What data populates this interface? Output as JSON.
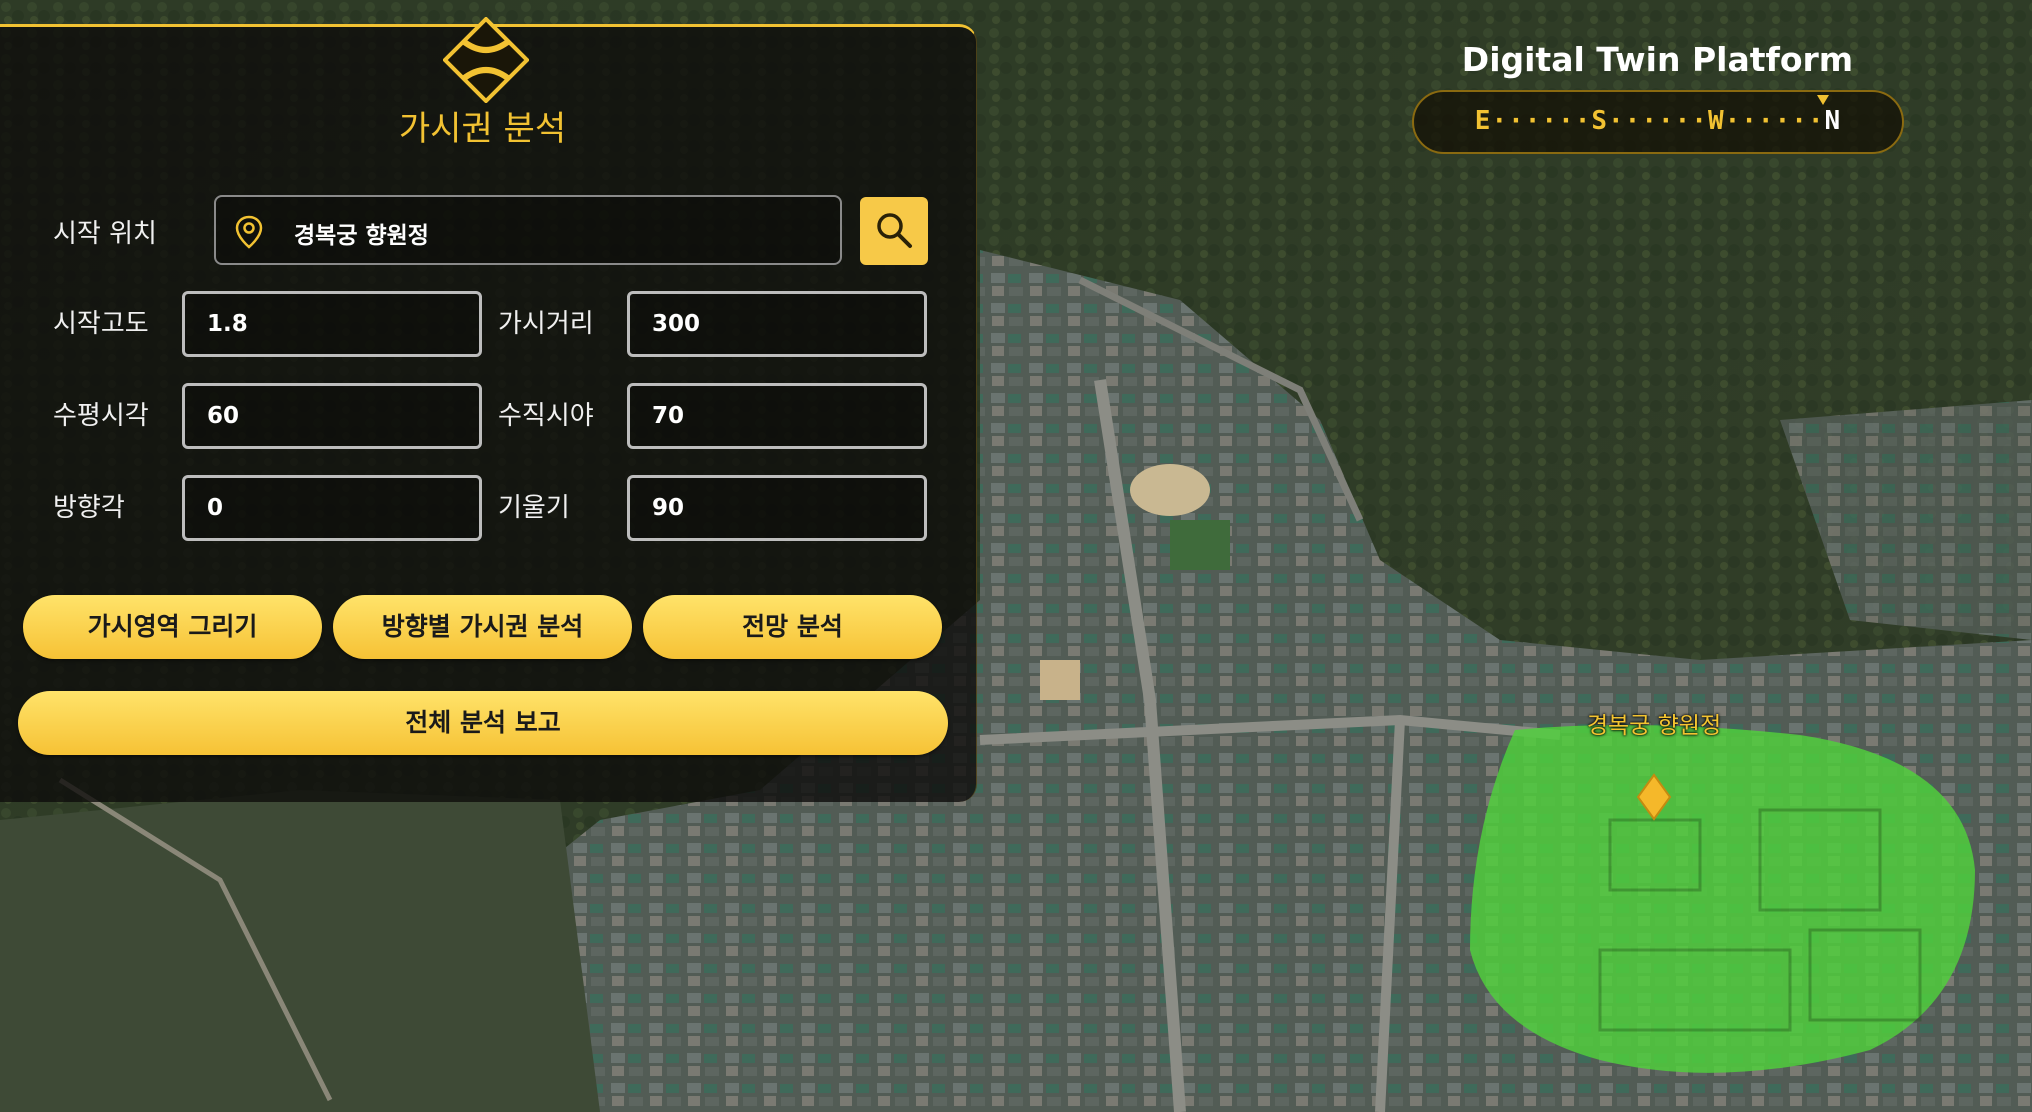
{
  "app": {
    "platform_title": "Digital Twin Platform"
  },
  "panel": {
    "title": "가시권 분석",
    "start_location": {
      "label": "시작 위치",
      "value": "경복궁 향원정"
    },
    "fields": {
      "start_altitude": {
        "label": "시작고도",
        "value": "1.8"
      },
      "view_distance": {
        "label": "가시거리",
        "value": "300"
      },
      "horizontal_fov": {
        "label": "수평시각",
        "value": "60"
      },
      "vertical_fov": {
        "label": "수직시야",
        "value": "70"
      },
      "heading": {
        "label": "방향각",
        "value": "0"
      },
      "tilt": {
        "label": "기울기",
        "value": "90"
      }
    },
    "buttons": {
      "draw_area": "가시영역 그리기",
      "directional": "방향별 가시권 분석",
      "view_analysis": "전망 분석",
      "full_report": "전체 분석 보고"
    }
  },
  "compass": {
    "letters": [
      "E",
      "S",
      "W",
      "N"
    ],
    "active": "N"
  },
  "map": {
    "marker_label": "경복궁 향원정",
    "highlight_color": "#4fd23c"
  },
  "colors": {
    "accent": "#f2c232",
    "button": "#f7c948"
  },
  "icons": {
    "location": "location-pin-icon",
    "search": "search-icon",
    "emblem": "emblem-icon",
    "marker": "diamond-marker-icon"
  }
}
